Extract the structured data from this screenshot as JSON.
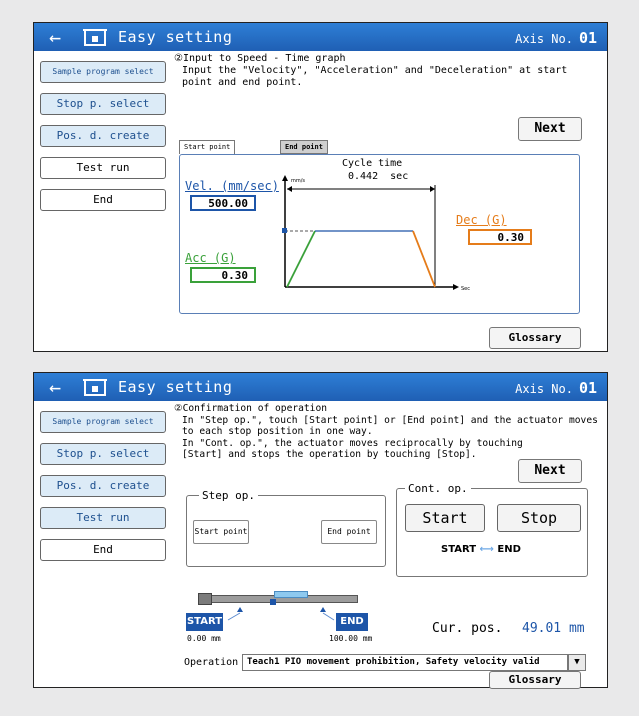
{
  "screen1": {
    "title": "Easy setting",
    "axis_label": "Axis No.",
    "axis_no": "01",
    "steps": [
      {
        "label": "Sample program select"
      },
      {
        "label": "Stop p. select"
      },
      {
        "label": "Pos. d. create"
      },
      {
        "label": "Test run"
      },
      {
        "label": "End"
      }
    ],
    "instruction_line1": "②Input to Speed - Time graph",
    "instruction_line2": "Input the \"Velocity\", \"Acceleration\" and \"Deceleration\" at start",
    "instruction_line3": "point and end point.",
    "next_label": "Next",
    "tab_start": "Start point",
    "tab_end": "End point",
    "cycle_time_label": "Cycle time",
    "cycle_time_value": "0.442",
    "cycle_time_unit": "sec",
    "vel_label": "Vel. (mm/sec)",
    "vel_value": "500.00",
    "acc_label": "Acc (G)",
    "acc_value": "0.30",
    "dec_label": "Dec (G)",
    "dec_value": "0.30",
    "y_axis_unit": "mm/s",
    "x_axis_unit": "Sec",
    "glossary_label": "Glossary"
  },
  "screen2": {
    "title": "Easy setting",
    "axis_label": "Axis No.",
    "axis_no": "01",
    "steps": [
      {
        "label": "Sample program select"
      },
      {
        "label": "Stop p. select"
      },
      {
        "label": "Pos. d. create"
      },
      {
        "label": "Test run"
      },
      {
        "label": "End"
      }
    ],
    "instruction_line1": "②Confirmation of operation",
    "instruction_line2": "In \"Step op.\", touch [Start point] or [End point] and the actuator moves",
    "instruction_line3": "to each stop position in one way.",
    "instruction_line4": "In \"Cont. op.\", the actuator moves reciprocally by touching",
    "instruction_line5": "[Start] and stops the operation by touching [Stop].",
    "next_label": "Next",
    "step_op_label": "Step op.",
    "start_point_btn": "Start point",
    "end_point_btn": "End point",
    "cont_op_label": "Cont. op.",
    "start_btn": "Start",
    "stop_btn": "Stop",
    "start_end_start": "START",
    "start_end_end": "END",
    "rail_start_label": "START",
    "rail_start_value": "0.00 mm",
    "rail_end_label": "END",
    "rail_end_value": "100.00 mm",
    "cur_pos_label": "Cur. pos.",
    "cur_pos_value": "49.01 mm",
    "operation_label": "Operation",
    "operation_value": "Teach1 PIO movement prohibition, Safety velocity valid",
    "glossary_label": "Glossary"
  },
  "colors": {
    "title_bar": "#1f5fb4",
    "velocity": "#1d55a8",
    "acceleration": "#3aa13a",
    "deceleration": "#e57c1a"
  },
  "icons": [
    "back-arrow-icon",
    "home-icon",
    "dropdown-arrow-icon",
    "double-arrow-icon"
  ]
}
